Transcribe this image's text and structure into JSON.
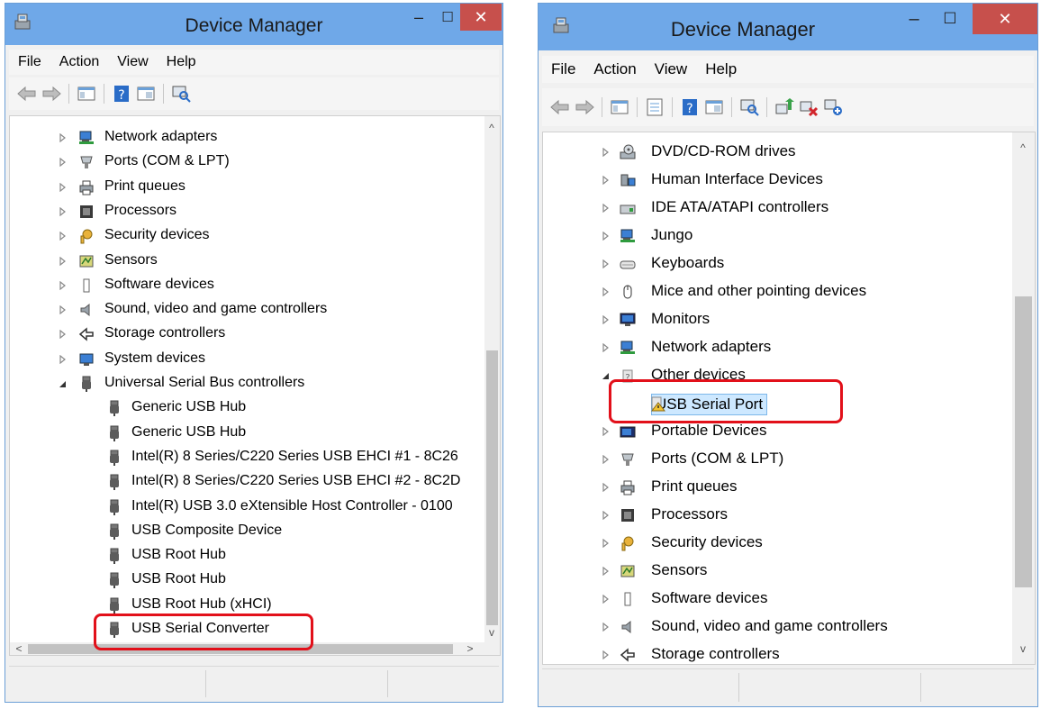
{
  "left": {
    "title": "Device Manager",
    "min_glyph": "–",
    "max_glyph": "☐",
    "close_glyph": "✕",
    "menus": [
      "File",
      "Action",
      "View",
      "Help"
    ],
    "scroll_up": "^",
    "scroll_down": "v",
    "scroll_left": "<",
    "scroll_right": ">",
    "tree": [
      {
        "label": "Network adapters",
        "icon": "network-adapter-icon",
        "expander": "collapsed"
      },
      {
        "label": "Ports (COM & LPT)",
        "icon": "port-icon",
        "expander": "collapsed"
      },
      {
        "label": "Print queues",
        "icon": "printer-icon",
        "expander": "collapsed"
      },
      {
        "label": "Processors",
        "icon": "processor-icon",
        "expander": "collapsed"
      },
      {
        "label": "Security devices",
        "icon": "security-key-icon",
        "expander": "collapsed"
      },
      {
        "label": "Sensors",
        "icon": "sensor-icon",
        "expander": "collapsed"
      },
      {
        "label": "Software devices",
        "icon": "software-device-icon",
        "expander": "collapsed"
      },
      {
        "label": "Sound, video and game controllers",
        "icon": "speaker-icon",
        "expander": "collapsed"
      },
      {
        "label": "Storage controllers",
        "icon": "storage-icon",
        "expander": "collapsed"
      },
      {
        "label": "System devices",
        "icon": "system-device-icon",
        "expander": "collapsed"
      },
      {
        "label": "Universal Serial Bus controllers",
        "icon": "usb-icon",
        "expander": "expanded"
      },
      {
        "label": "Generic USB Hub",
        "icon": "usb-icon",
        "expander": "none"
      },
      {
        "label": "Generic USB Hub",
        "icon": "usb-icon",
        "expander": "none"
      },
      {
        "label": "Intel(R) 8 Series/C220 Series USB EHCI #1 - 8C26",
        "icon": "usb-icon",
        "expander": "none"
      },
      {
        "label": "Intel(R) 8 Series/C220 Series USB EHCI #2 - 8C2D",
        "icon": "usb-icon",
        "expander": "none"
      },
      {
        "label": "Intel(R) USB 3.0 eXtensible Host Controller - 0100",
        "icon": "usb-icon",
        "expander": "none"
      },
      {
        "label": "USB Composite Device",
        "icon": "usb-icon",
        "expander": "none"
      },
      {
        "label": "USB Root Hub",
        "icon": "usb-icon",
        "expander": "none"
      },
      {
        "label": "USB Root Hub",
        "icon": "usb-icon",
        "expander": "none"
      },
      {
        "label": "USB Root Hub (xHCI)",
        "icon": "usb-icon",
        "expander": "none"
      },
      {
        "label": "USB Serial Converter",
        "icon": "usb-icon",
        "expander": "none"
      }
    ]
  },
  "right": {
    "title": "Device Manager",
    "min_glyph": "–",
    "max_glyph": "☐",
    "close_glyph": "✕",
    "menus": [
      "File",
      "Action",
      "View",
      "Help"
    ],
    "scroll_up": "^",
    "scroll_down": "v",
    "tree": [
      {
        "label": "DVD/CD-ROM drives",
        "icon": "dvd-drive-icon",
        "expander": "collapsed"
      },
      {
        "label": "Human Interface Devices",
        "icon": "hid-icon",
        "expander": "collapsed"
      },
      {
        "label": "IDE ATA/ATAPI controllers",
        "icon": "ide-controller-icon",
        "expander": "collapsed"
      },
      {
        "label": "Jungo",
        "icon": "network-adapter-icon",
        "expander": "collapsed"
      },
      {
        "label": "Keyboards",
        "icon": "keyboard-icon",
        "expander": "collapsed"
      },
      {
        "label": "Mice and other pointing devices",
        "icon": "mouse-icon",
        "expander": "collapsed"
      },
      {
        "label": "Monitors",
        "icon": "monitor-icon",
        "expander": "collapsed"
      },
      {
        "label": "Network adapters",
        "icon": "network-adapter-icon",
        "expander": "collapsed"
      },
      {
        "label": "Other devices",
        "icon": "unknown-device-icon",
        "expander": "expanded"
      },
      {
        "label": "USB Serial Port",
        "icon": "warning-device-icon",
        "expander": "none"
      },
      {
        "label": "Portable Devices",
        "icon": "portable-device-icon",
        "expander": "collapsed"
      },
      {
        "label": "Ports (COM & LPT)",
        "icon": "port-icon",
        "expander": "collapsed"
      },
      {
        "label": "Print queues",
        "icon": "printer-icon",
        "expander": "collapsed"
      },
      {
        "label": "Processors",
        "icon": "processor-icon",
        "expander": "collapsed"
      },
      {
        "label": "Security devices",
        "icon": "security-key-icon",
        "expander": "collapsed"
      },
      {
        "label": "Sensors",
        "icon": "sensor-icon",
        "expander": "collapsed"
      },
      {
        "label": "Software devices",
        "icon": "software-device-icon",
        "expander": "collapsed"
      },
      {
        "label": "Sound, video and game controllers",
        "icon": "speaker-icon",
        "expander": "collapsed"
      },
      {
        "label": "Storage controllers",
        "icon": "storage-icon",
        "expander": "collapsed"
      }
    ]
  }
}
